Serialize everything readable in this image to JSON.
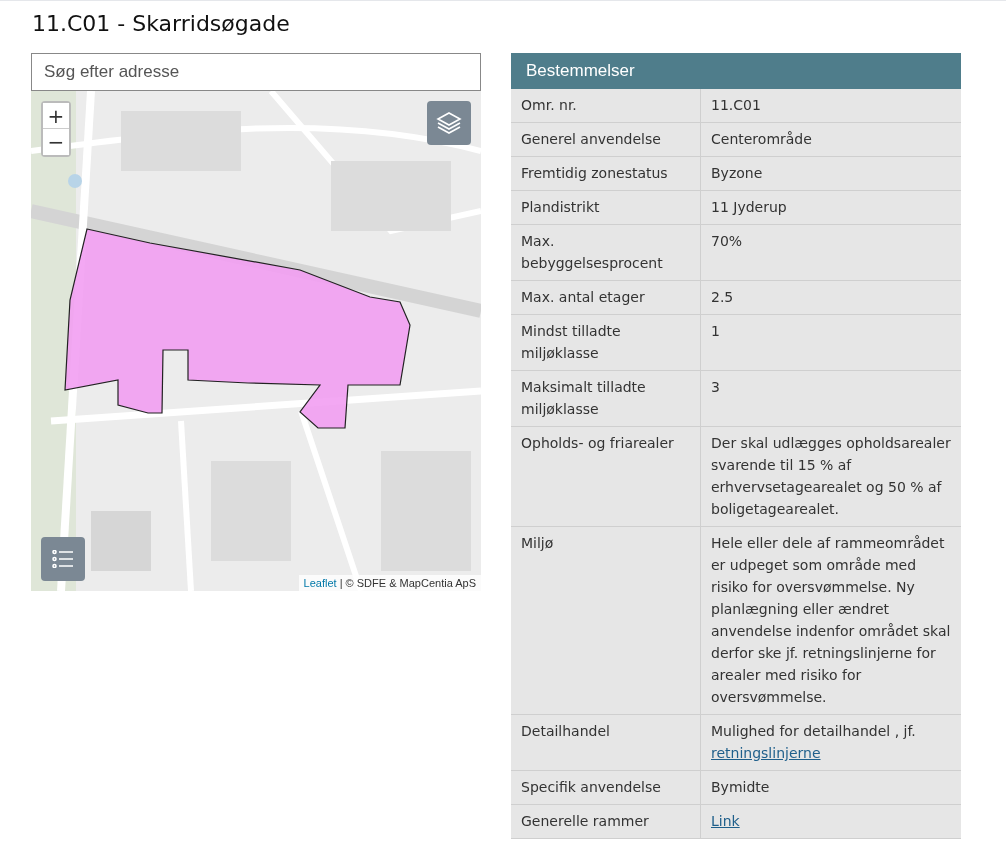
{
  "title": "11.C01 - Skarridsøgade",
  "search": {
    "placeholder": "Søg efter adresse"
  },
  "map": {
    "zoom_in": "+",
    "zoom_out": "−",
    "attribution_link": "Leaflet",
    "attribution": " | © SDFE & MapCentia ApS"
  },
  "table": {
    "heading": "Bestemmelser",
    "rows": [
      {
        "label": "Omr. nr.",
        "value": [
          {
            "kind": "text",
            "text": "11.C01"
          }
        ]
      },
      {
        "label": "Generel anvendelse",
        "value": [
          {
            "kind": "text",
            "text": "Centerområde"
          }
        ]
      },
      {
        "label": "Fremtidig zonestatus",
        "value": [
          {
            "kind": "text",
            "text": "Byzone"
          }
        ]
      },
      {
        "label": "Plandistrikt",
        "value": [
          {
            "kind": "text",
            "text": "11 Jyderup"
          }
        ]
      },
      {
        "label": "Max. bebyggelsesprocent",
        "value": [
          {
            "kind": "text",
            "text": "70%"
          }
        ]
      },
      {
        "label": "Max. antal etager",
        "value": [
          {
            "kind": "text",
            "text": "2.5"
          }
        ]
      },
      {
        "label": "Mindst tilladte miljøklasse",
        "value": [
          {
            "kind": "text",
            "text": "1"
          }
        ]
      },
      {
        "label": "Maksimalt tilladte miljøklasse",
        "value": [
          {
            "kind": "text",
            "text": "3"
          }
        ]
      },
      {
        "label": "Opholds- og friarealer",
        "value": [
          {
            "kind": "text",
            "text": "Der skal udlægges opholdsarealer svarende til 15 % af erhvervsetagearealet og 50 % af boligetagearealet."
          }
        ]
      },
      {
        "label": "Miljø",
        "value": [
          {
            "kind": "text",
            "text": "Hele eller dele af rammeområdet er udpeget som område med risiko for oversvømmelse. Ny planlægning eller ændret anvendelse indenfor området skal derfor ske jf. retningslinjerne for arealer med risiko for oversvømmelse."
          }
        ]
      },
      {
        "label": "Detailhandel",
        "value": [
          {
            "kind": "text",
            "text": "Mulighed for detailhandel , jf."
          },
          {
            "kind": "link",
            "text": "retningslinjerne"
          }
        ]
      },
      {
        "label": "Specifik anvendelse",
        "value": [
          {
            "kind": "text",
            "text": "Bymidte"
          }
        ]
      },
      {
        "label": "Generelle rammer",
        "value": [
          {
            "kind": "link",
            "text": "Link"
          }
        ]
      }
    ]
  }
}
